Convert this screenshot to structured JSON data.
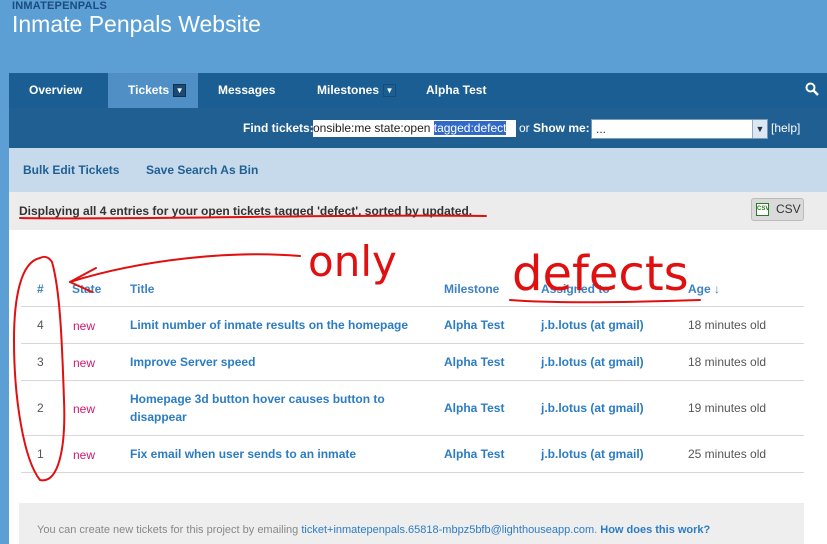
{
  "header": {
    "account": "INMATEPENPALS",
    "title": "Inmate Penpals Website"
  },
  "nav": {
    "tabs": [
      {
        "label": "Overview"
      },
      {
        "label": "Tickets",
        "active": true
      },
      {
        "label": "Messages"
      },
      {
        "label": "Milestones"
      },
      {
        "label": "Alpha Test"
      }
    ],
    "search_icon": "search-icon"
  },
  "find": {
    "label": "Find tickets:",
    "query_plain": "onsible:me state:open ",
    "query_selected": "tagged:defect",
    "or": "or",
    "show_label": "Show me:",
    "show_value": "...",
    "help": "[help]"
  },
  "actions": {
    "bulk": "Bulk Edit Tickets",
    "save": "Save Search As Bin"
  },
  "summary": {
    "text": "Displaying all 4 entries for your open tickets tagged 'defect', sorted by updated.",
    "csv": "CSV"
  },
  "table": {
    "headers": {
      "num": "#",
      "state": "State",
      "title": "Title",
      "milestone": "Milestone",
      "assigned": "Assigned to",
      "age": "Age ↓"
    },
    "rows": [
      {
        "num": "4",
        "state": "new",
        "title": "Limit number of inmate results on the homepage",
        "title2": "",
        "milestone": "Alpha Test",
        "assigned": "j.b.lotus (at gmail)",
        "age": "18 minutes old"
      },
      {
        "num": "3",
        "state": "new",
        "title": "Improve Server speed",
        "title2": "",
        "milestone": "Alpha Test",
        "assigned": "j.b.lotus (at gmail)",
        "age": "18 minutes old"
      },
      {
        "num": "2",
        "state": "new",
        "title": "Homepage 3d button hover causes button to",
        "title2": "disappear",
        "milestone": "Alpha Test",
        "assigned": "j.b.lotus (at gmail)",
        "age": "19 minutes old"
      },
      {
        "num": "1",
        "state": "new",
        "title": "Fix email when user sends to an inmate",
        "title2": "",
        "milestone": "Alpha Test",
        "assigned": "j.b.lotus (at gmail)",
        "age": "25 minutes old"
      }
    ]
  },
  "footer": {
    "text": "You can create new tickets for this project by emailing ",
    "email": "ticket+inmatepenpals.65818-mbpz5bfb@lighthouseapp.com",
    "dot": ". ",
    "how": "How does this work?"
  },
  "annotations": {
    "word1": "only",
    "word2": "defects",
    "color": "#e01010"
  },
  "colors": {
    "nav": "#1a5e94",
    "link": "#2b7cc4",
    "state_new": "#d2186b"
  }
}
